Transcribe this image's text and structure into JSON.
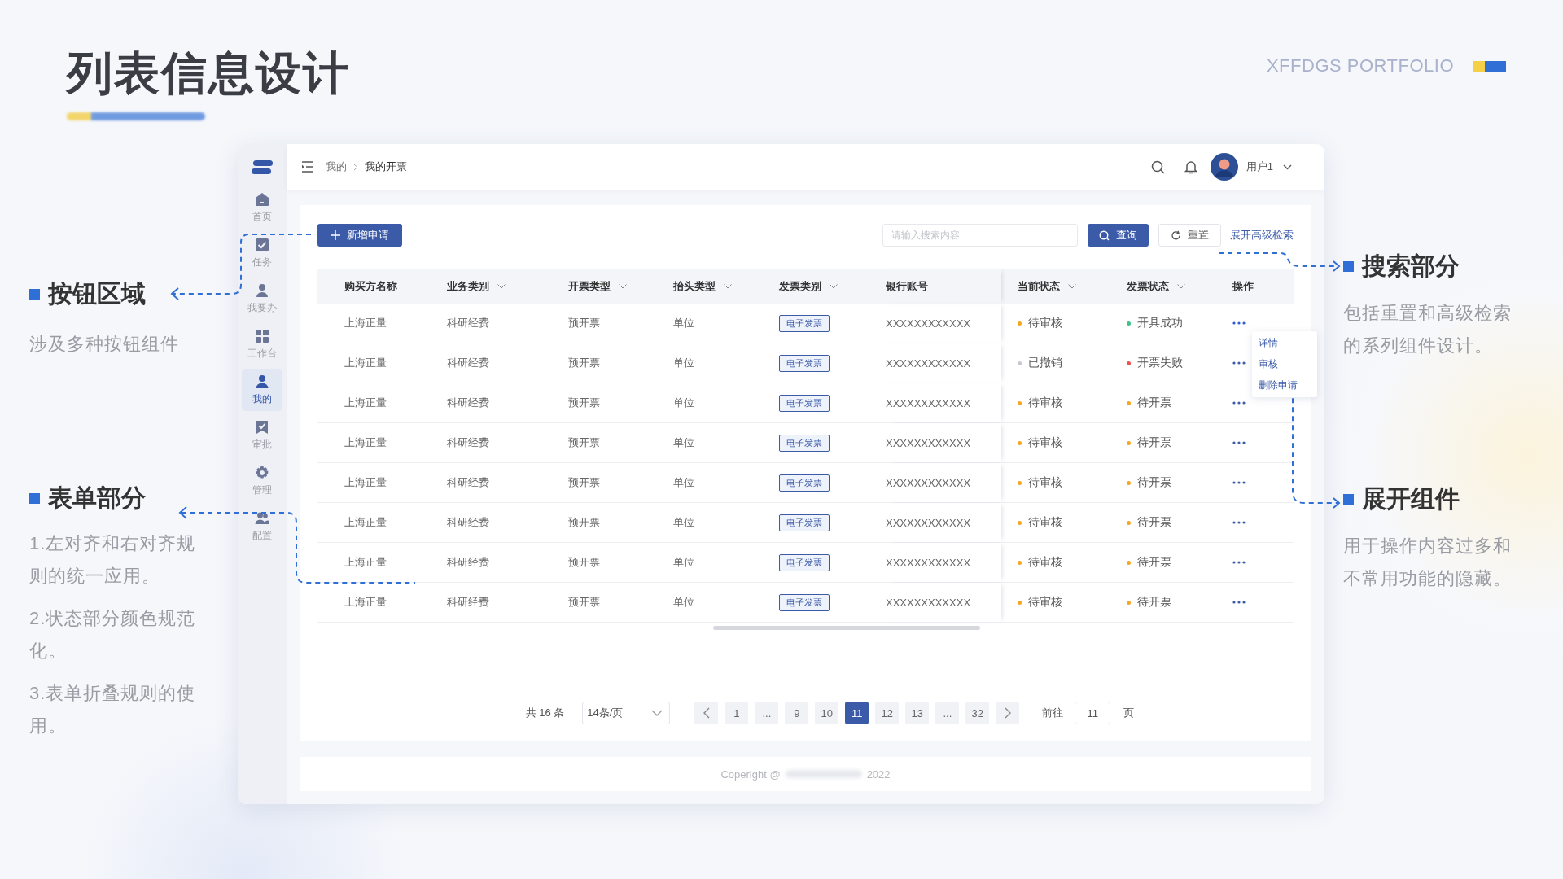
{
  "slide": {
    "title": "列表信息设计",
    "brand": "XFFDGS PORTFOLIO"
  },
  "left_notes": [
    {
      "title": "按钮区域",
      "paragraphs": [
        "涉及多种按钮组件"
      ]
    },
    {
      "title": "表单部分",
      "paragraphs": [
        "1.左对齐和右对齐规则的统一应用。",
        "2.状态部分颜色规范化。",
        "3.表单折叠规则的使用。"
      ]
    }
  ],
  "right_notes": [
    {
      "title": "搜索部分",
      "paragraphs": [
        "包括重置和高级检索的系列组件设计。"
      ]
    },
    {
      "title": "展开组件",
      "paragraphs": [
        "用于操作内容过多和不常用功能的隐藏。"
      ]
    }
  ],
  "app": {
    "sidebar": {
      "items": [
        {
          "label": "首页",
          "selected": false
        },
        {
          "label": "任务",
          "selected": false
        },
        {
          "label": "我要办",
          "selected": false
        },
        {
          "label": "工作台",
          "selected": false
        },
        {
          "label": "我的",
          "selected": true
        },
        {
          "label": "审批",
          "selected": false
        },
        {
          "label": "管理",
          "selected": false
        },
        {
          "label": "配置",
          "selected": false
        }
      ]
    },
    "header": {
      "breadcrumb": [
        "我的",
        "我的开票"
      ],
      "user": "用户1"
    },
    "toolbar": {
      "add_button": "新增申请",
      "search": {
        "placeholder": "请输入搜索内容"
      },
      "search_button": "查询",
      "reset_button": "重置",
      "advanced_link": "展开高级检索"
    },
    "table": {
      "columns": [
        {
          "label": "购买方名称",
          "sortable": false
        },
        {
          "label": "业务类别",
          "sortable": true
        },
        {
          "label": "开票类型",
          "sortable": true
        },
        {
          "label": "抬头类型",
          "sortable": true
        },
        {
          "label": "发票类别",
          "sortable": true
        },
        {
          "label": "银行账号",
          "sortable": false
        },
        {
          "label": "当前状态",
          "sortable": true
        },
        {
          "label": "发票状态",
          "sortable": true
        },
        {
          "label": "操作",
          "sortable": false
        }
      ],
      "rows": [
        {
          "buyer": "上海正量",
          "business": "科研经费",
          "issue_type": "预开票",
          "title_type": "单位",
          "category": "电子发票",
          "account": "XXXXXXXXXXXX",
          "status": {
            "text": "待审核",
            "color": "#f5a623"
          },
          "invoice_status": {
            "text": "开具成功",
            "color": "#3cc28a"
          },
          "expanded": true
        },
        {
          "buyer": "上海正量",
          "business": "科研经费",
          "issue_type": "预开票",
          "title_type": "单位",
          "category": "电子发票",
          "account": "XXXXXXXXXXXX",
          "status": {
            "text": "已撤销",
            "color": "#c4c8d0"
          },
          "invoice_status": {
            "text": "开票失败",
            "color": "#f0504f"
          },
          "expanded": false
        },
        {
          "buyer": "上海正量",
          "business": "科研经费",
          "issue_type": "预开票",
          "title_type": "单位",
          "category": "电子发票",
          "account": "XXXXXXXXXXXX",
          "status": {
            "text": "待审核",
            "color": "#f5a623"
          },
          "invoice_status": {
            "text": "待开票",
            "color": "#f5a623"
          },
          "expanded": false
        },
        {
          "buyer": "上海正量",
          "business": "科研经费",
          "issue_type": "预开票",
          "title_type": "单位",
          "category": "电子发票",
          "account": "XXXXXXXXXXXX",
          "status": {
            "text": "待审核",
            "color": "#f5a623"
          },
          "invoice_status": {
            "text": "待开票",
            "color": "#f5a623"
          },
          "expanded": false
        },
        {
          "buyer": "上海正量",
          "business": "科研经费",
          "issue_type": "预开票",
          "title_type": "单位",
          "category": "电子发票",
          "account": "XXXXXXXXXXXX",
          "status": {
            "text": "待审核",
            "color": "#f5a623"
          },
          "invoice_status": {
            "text": "待开票",
            "color": "#f5a623"
          },
          "expanded": false
        },
        {
          "buyer": "上海正量",
          "business": "科研经费",
          "issue_type": "预开票",
          "title_type": "单位",
          "category": "电子发票",
          "account": "XXXXXXXXXXXX",
          "status": {
            "text": "待审核",
            "color": "#f5a623"
          },
          "invoice_status": {
            "text": "待开票",
            "color": "#f5a623"
          },
          "expanded": false
        },
        {
          "buyer": "上海正量",
          "business": "科研经费",
          "issue_type": "预开票",
          "title_type": "单位",
          "category": "电子发票",
          "account": "XXXXXXXXXXXX",
          "status": {
            "text": "待审核",
            "color": "#f5a623"
          },
          "invoice_status": {
            "text": "待开票",
            "color": "#f5a623"
          },
          "expanded": false
        },
        {
          "buyer": "上海正量",
          "business": "科研经费",
          "issue_type": "预开票",
          "title_type": "单位",
          "category": "电子发票",
          "account": "XXXXXXXXXXXX",
          "status": {
            "text": "待审核",
            "color": "#f5a623"
          },
          "invoice_status": {
            "text": "待开票",
            "color": "#f5a623"
          },
          "expanded": false
        }
      ],
      "row_menu": [
        "详情",
        "审核",
        "删除申请"
      ]
    },
    "pagination": {
      "total": "共 16 条",
      "page_size": "14条/页",
      "pages": [
        {
          "label": "1",
          "selected": false
        },
        {
          "label": "...",
          "selected": false
        },
        {
          "label": "9",
          "selected": false
        },
        {
          "label": "10",
          "selected": false
        },
        {
          "label": "11",
          "selected": true
        },
        {
          "label": "12",
          "selected": false
        },
        {
          "label": "13",
          "selected": false
        },
        {
          "label": "...",
          "selected": false
        },
        {
          "label": "32",
          "selected": false
        }
      ],
      "goto_label": "前往",
      "goto_value": "11",
      "goto_unit": "页"
    },
    "footer": {
      "prefix": "Coperight @",
      "year": "2022"
    }
  }
}
